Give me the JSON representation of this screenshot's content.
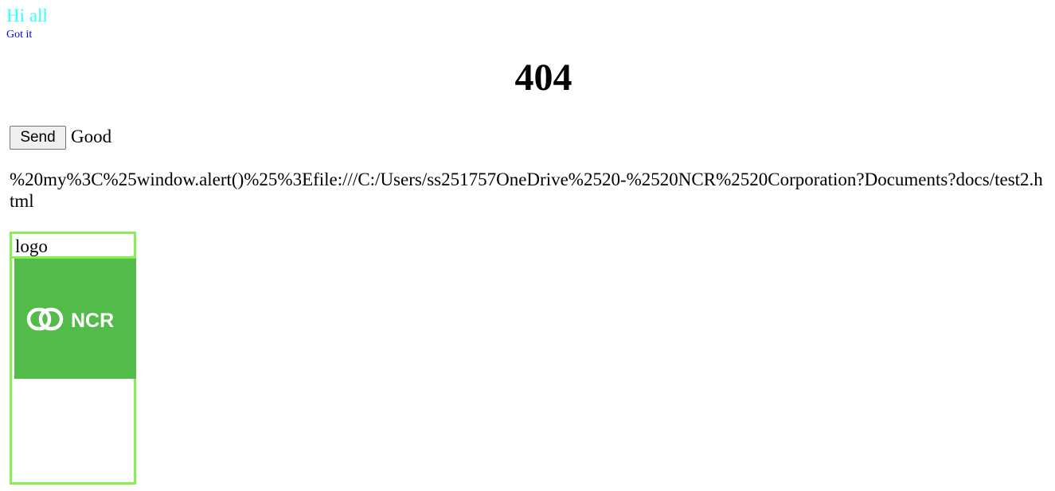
{
  "header": {
    "greeting": "Hi all",
    "got_it_link": "Got it"
  },
  "main": {
    "heading": "404",
    "send_button": "Send",
    "status_text": "Good",
    "path_text": "%20my%3C%25window.alert()%25%3Efile:///C:/Users/ss251757OneDrive%2520-%2520NCR%2520Corporation?Documents?docs/test2.html"
  },
  "logo_box": {
    "label": "logo",
    "image_text": "NCR",
    "image_alt": "NCR logo"
  },
  "colors": {
    "greeting": "#33ffff",
    "link": "#0000ee",
    "frame_border": "#88ee55",
    "logo_background": "#52bb49"
  },
  "icons": {
    "logo_mark": "ncr-interlocked-rings-icon"
  }
}
